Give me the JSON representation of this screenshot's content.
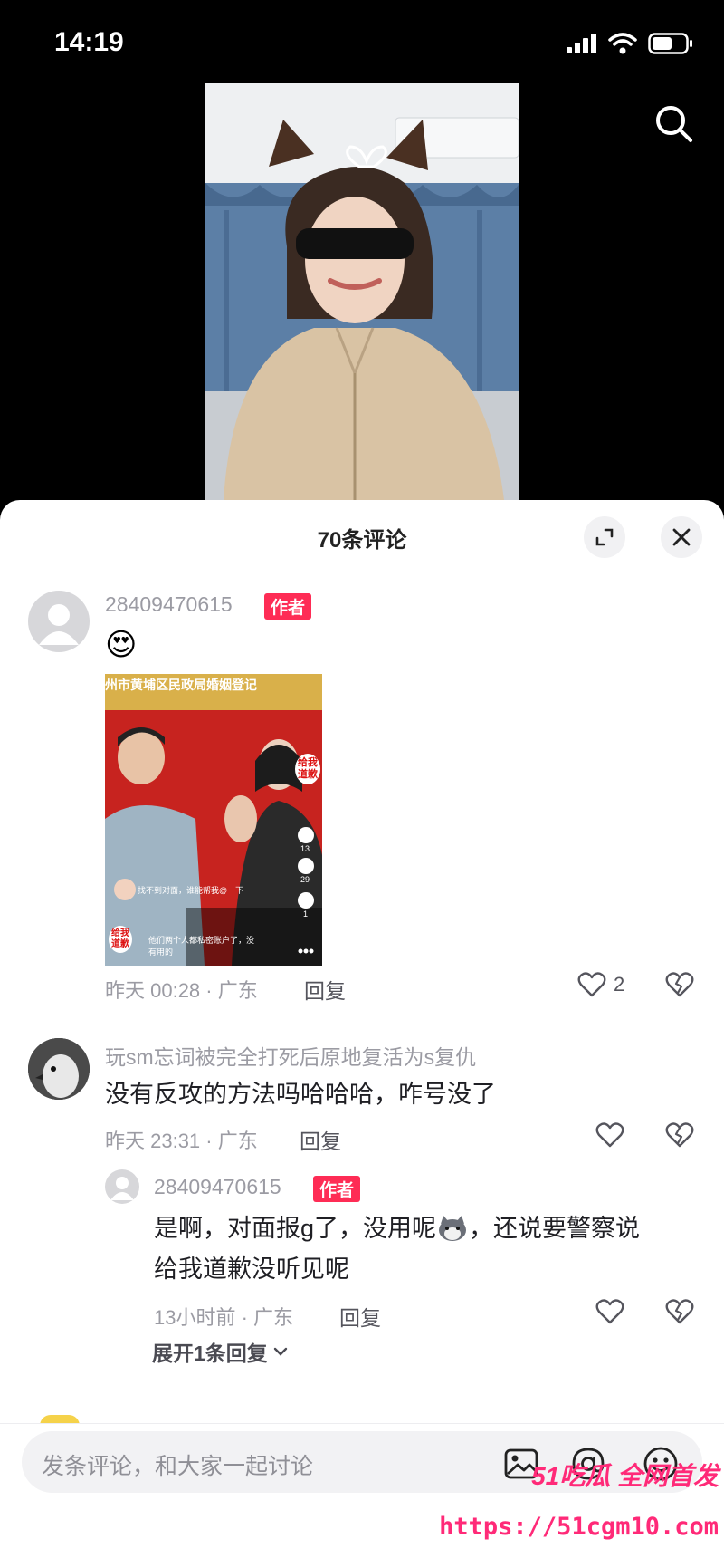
{
  "status_bar": {
    "time": "14:19",
    "signal_icon": "signal-icon",
    "wifi_icon": "wifi-icon",
    "battery_icon": "battery-icon"
  },
  "video": {
    "search_icon": "search-icon"
  },
  "sheet": {
    "title": "70条评论",
    "expand_icon": "expand-icon",
    "close_icon": "close-icon"
  },
  "comments": [
    {
      "username": "28409470615",
      "author_badge": "作者",
      "emoji": "😍",
      "time_location": "昨天 00:28 · 广东",
      "reply_label": "回复",
      "likes": "2"
    },
    {
      "username": "玩sm忘词被完全打死后原地复活为s复仇",
      "text": "没有反攻的方法吗哈哈哈，咋号没了",
      "time_location": "昨天 23:31 · 广东",
      "reply_label": "回复",
      "replies": [
        {
          "username": "28409470615",
          "author_badge": "作者",
          "text_line1": "是啊，对面报g了，没用呢",
          "text_line1b": "，还说要警察说",
          "text_line2": "给我道歉没听见呢",
          "time_location": "13小时前 · 广东",
          "reply_label": "回复"
        }
      ],
      "expand_label": "展开1条回复"
    }
  ],
  "screenshot_card": {
    "banner": "州市黄埔区民政局婚姻登记",
    "sticker": "给我道歉",
    "overlay_line1": "找不到对面，谁能帮我@一下",
    "overlay_line2": "他们两个人都私密账户了，没有用的",
    "counts": [
      "13",
      "29",
      "1"
    ]
  },
  "input": {
    "placeholder": "发条评论，和大家一起讨论"
  },
  "watermark": {
    "brand": "51吃瓜 全网首发",
    "url": "https://51cgm10.com"
  },
  "colors": {
    "accent": "#fe2c55",
    "sheet_bg": "#ffffff",
    "muted_text": "#9b9ba3"
  }
}
